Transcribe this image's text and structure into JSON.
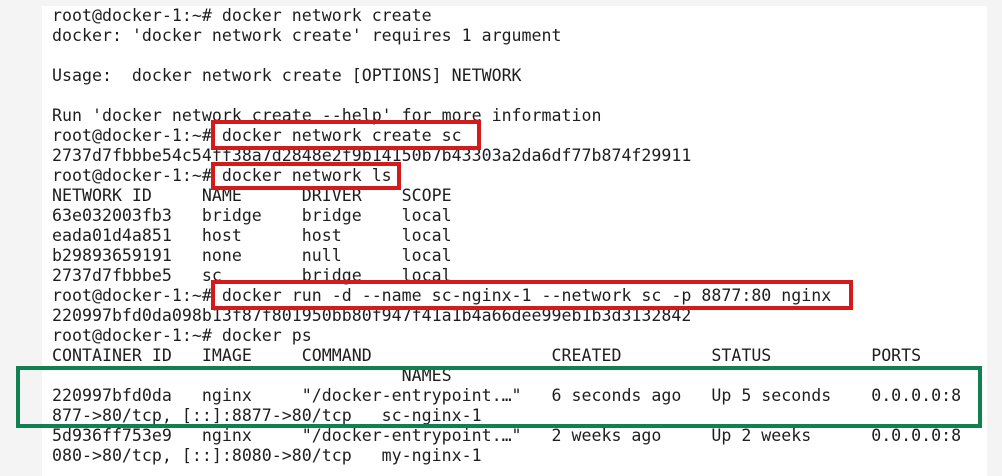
{
  "colors": {
    "text": "#1e1e1e",
    "background": "#ffffff",
    "highlight_red": "#d41a1a",
    "highlight_green": "#108050"
  },
  "terminal": {
    "lines": [
      "root@docker-1:~# docker network create",
      "docker: 'docker network create' requires 1 argument",
      "",
      "Usage:  docker network create [OPTIONS] NETWORK",
      "",
      "Run 'docker network create --help' for more information",
      "root@docker-1:~# docker network create sc",
      "2737d7fbbbe54c54ff38a7d2848e2f9b14150b7b43303a2da6df77b874f29911",
      "root@docker-1:~# docker network ls",
      "NETWORK ID     NAME      DRIVER    SCOPE",
      "63e032003fb3   bridge    bridge    local",
      "eada01d4a851   host      host      local",
      "b29893659191   none      null      local",
      "2737d7fbbbe5   sc        bridge    local",
      "root@docker-1:~# docker run -d --name sc-nginx-1 --network sc -p 8877:80 nginx",
      "220997bfd0da098b13f87f801950bb80f947f41a1b4a66dee99eb1b3d3132842",
      "root@docker-1:~# docker ps",
      "CONTAINER ID   IMAGE     COMMAND                  CREATED         STATUS          PORTS",
      "                                   NAMES",
      "220997bfd0da   nginx     \"/docker-entrypoint.…\"   6 seconds ago   Up 5 seconds    0.0.0.0:8",
      "877->80/tcp, [::]:8877->80/tcp   sc-nginx-1",
      "5d936ff753e9   nginx     \"/docker-entrypoint.…\"   2 weeks ago     Up 2 weeks      0.0.0.0:8",
      "080->80/tcp, [::]:8080->80/tcp   my-nginx-1"
    ]
  }
}
